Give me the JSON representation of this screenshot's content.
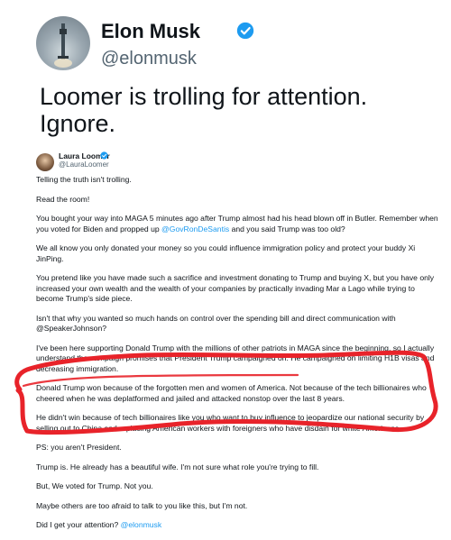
{
  "main": {
    "display_name": "Elon Musk",
    "handle": "@elonmusk",
    "text": "Loomer is trolling for attention. Ignore."
  },
  "quoted": {
    "display_name": "Laura Loomer",
    "handle": "@LauraLoomer",
    "paragraphs": [
      "Telling the truth isn't trolling.",
      "Read the room!",
      "You bought your way into MAGA 5 minutes ago after Trump almost had his head blown off in Butler. Remember when you voted for Biden and propped up",
      "We all know you only donated your money so you could influence immigration policy and protect your buddy Xi JinPing.",
      "You pretend like you have made such a sacrifice and investment donating to Trump and buying X, but you have only increased your own wealth and the wealth of your companies by practically invading Mar a Lago while trying to become Trump's side piece.",
      "Isn't that why you wanted so much hands on control over the spending bill and direct communication with @SpeakerJohnson?",
      "I've been here supporting Donald Trump with the millions of other patriots in MAGA since the beginning, so I actually understand the campaign promises that President Trump campaigned on. He campaigned on limiting H1B visas and decreasing immigration.",
      "Donald Trump won because of the forgotten men and women of America. Not because of the tech billionaires who cheered when he was deplatformed and jailed and attacked nonstop over the last 8 years.",
      "He didn't win because of tech billionaires like you who want to buy influence to jeopardize our national security by selling out to China and replacing American workers with foreigners who have disdain for white Americans.",
      "PS: you aren't President.",
      "Trump is. He already has a beautiful wife. I'm not sure what role you're trying to fill.",
      "But, We voted for Trump. Not you.",
      "Maybe others are too afraid to talk to you like this, but I'm not.",
      "Did I get your attention?"
    ],
    "p3_mention": "@GovRonDeSantis",
    "p3_tail": "and you said Trump was too old?",
    "last_mention": "@elonmusk"
  },
  "colors": {
    "verified": "#1d9bf0",
    "link": "#1d9bf0",
    "annotation": "#e8232a"
  }
}
